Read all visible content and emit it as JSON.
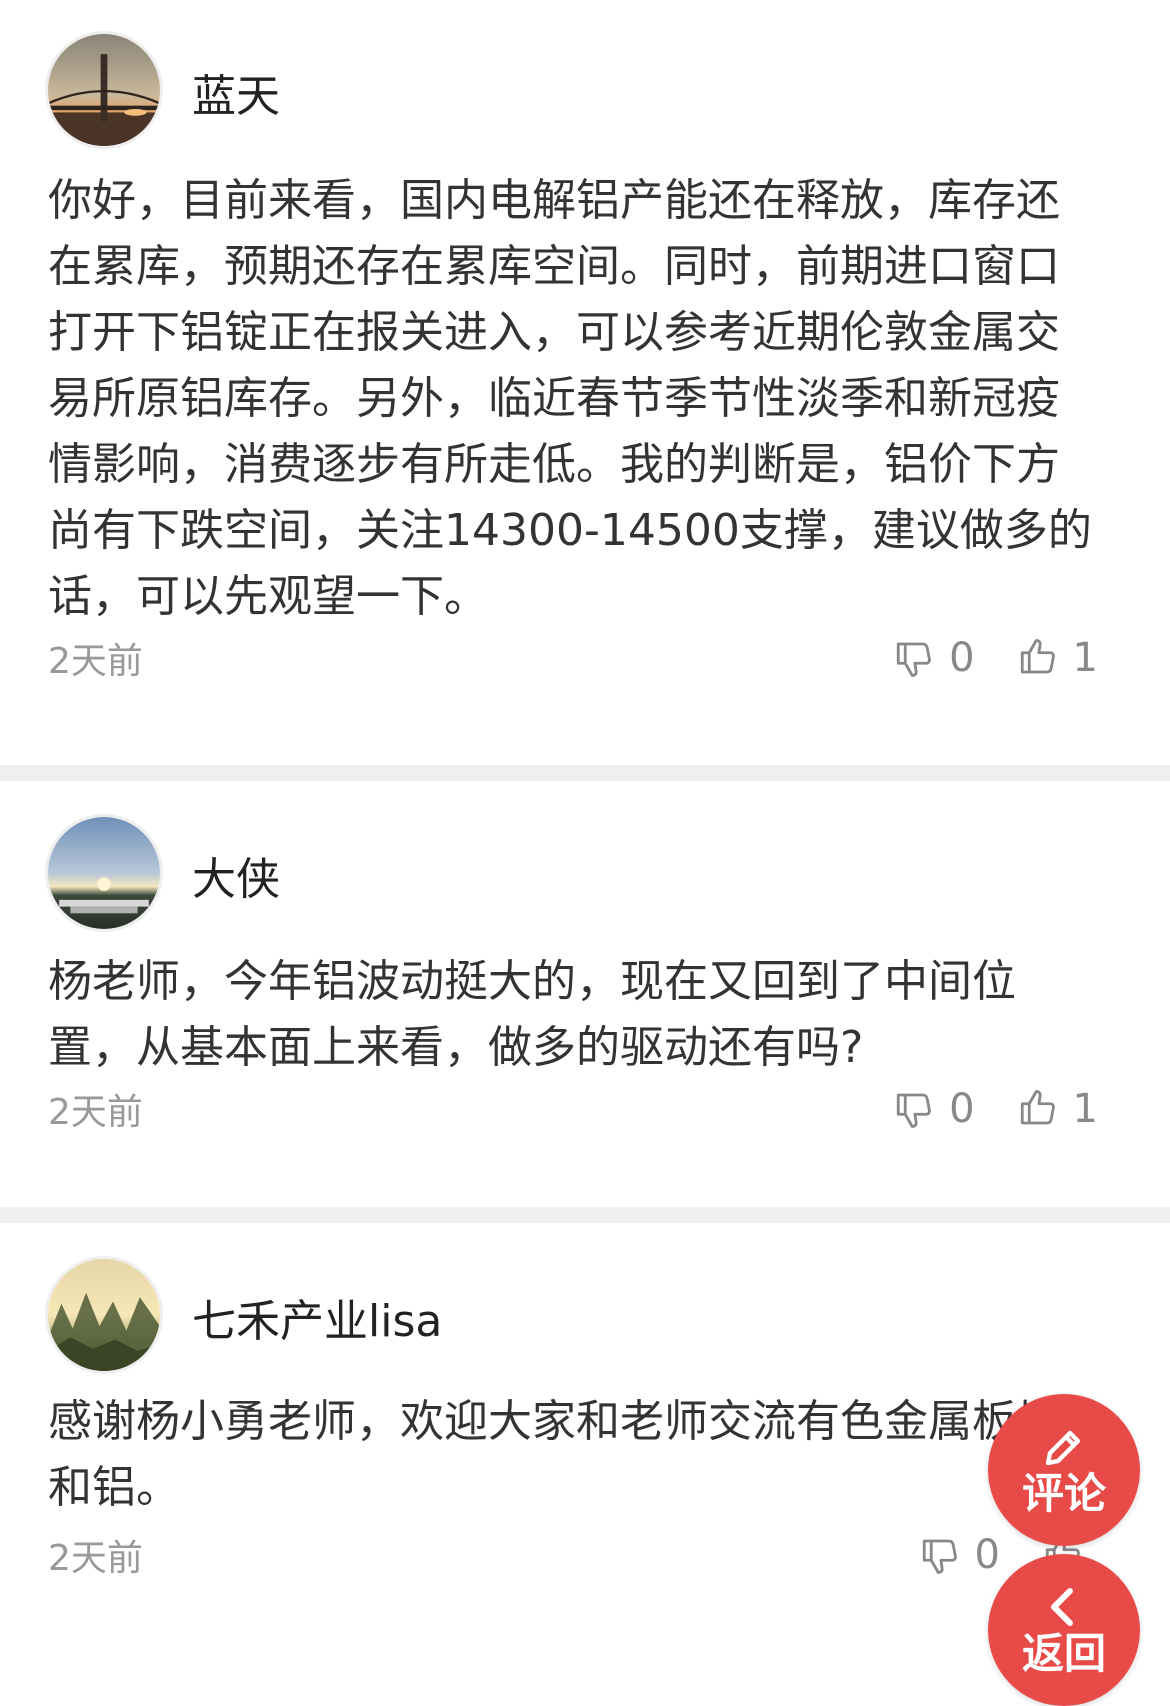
{
  "comments": [
    {
      "username": "蓝天",
      "body": "你好，目前来看，国内电解铝产能还在释放，库存还在累库，预期还存在累库空间。同时，前期进口窗口打开下铝锭正在报关进入，可以参考近期伦敦金属交易所原铝库存。另外，临近春节季节性淡季和新冠疫情影响，消费逐步有所走低。我的判断是，铝价下方尚有下跌空间，关注14300-14500支撑，建议做多的话，可以先观望一下。",
      "time": "2天前",
      "dislikes": "0",
      "likes": "1",
      "avatar": "bridge-sunset-avatar"
    },
    {
      "username": "大侠",
      "body": "杨老师，今年铝波动挺大的，现在又回到了中间位置，从基本面上来看，做多的驱动还有吗?",
      "time": "2天前",
      "dislikes": "0",
      "likes": "1",
      "avatar": "sunset-lake-avatar"
    },
    {
      "username": "七禾产业lisa",
      "body": "感谢杨小勇老师，欢迎大家和老师交流有色金属板块和铝。",
      "time": "2天前",
      "dislikes": "0",
      "likes": "",
      "avatar": "karst-mountains-avatar"
    }
  ],
  "fab": {
    "comment_label": "评论",
    "back_label": "返回"
  },
  "colors": {
    "accent": "#e84a48",
    "separator": "#efefef",
    "muted_text": "#999999"
  },
  "icons": {
    "dislike": "thumbs-down-icon",
    "like": "thumbs-up-icon",
    "comment": "pencil-icon",
    "back": "chevron-left-icon"
  }
}
